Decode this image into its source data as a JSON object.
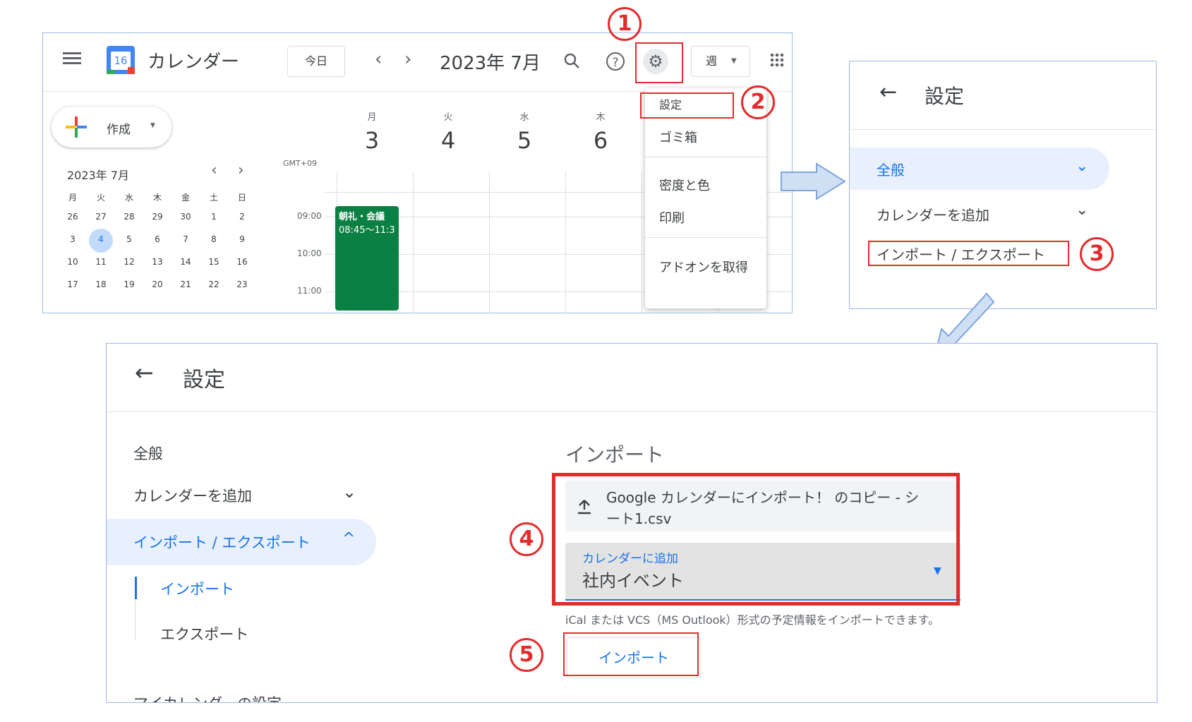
{
  "screen1": {
    "app_title": "カレンダー",
    "logo_day": "16",
    "today_button": "今日",
    "month_label": "2023年 7月",
    "view_button": "週",
    "create_button": "作成",
    "mini_cal": {
      "title": "2023年 7月",
      "weekdays": [
        "月",
        "火",
        "水",
        "木",
        "金",
        "土",
        "日"
      ],
      "weeks": [
        [
          "26",
          "27",
          "28",
          "29",
          "30",
          "1",
          "2"
        ],
        [
          "3",
          "4",
          "5",
          "6",
          "7",
          "8",
          "9"
        ],
        [
          "10",
          "11",
          "12",
          "13",
          "14",
          "15",
          "16"
        ],
        [
          "17",
          "18",
          "19",
          "20",
          "21",
          "22",
          "23"
        ]
      ]
    },
    "timezone": "GMT+09",
    "days": [
      {
        "weekday": "月",
        "date": "3"
      },
      {
        "weekday": "火",
        "date": "4"
      },
      {
        "weekday": "水",
        "date": "5"
      },
      {
        "weekday": "木",
        "date": "6"
      }
    ],
    "times": [
      "09:00",
      "10:00",
      "11:00"
    ],
    "event": {
      "title": "朝礼・会議",
      "time": "08:45〜11:3",
      "color": "#0b8043"
    },
    "settings_menu": [
      "設定",
      "ゴミ箱",
      "密度と色",
      "印刷",
      "アドオンを取得"
    ]
  },
  "screen2": {
    "title": "設定",
    "items": [
      "全般",
      "カレンダーを追加",
      "インポート / エクスポート"
    ]
  },
  "screen3": {
    "title": "設定",
    "nav": {
      "general": "全般",
      "add_calendar": "カレンダーを追加",
      "import_export": "インポート / エクスポート",
      "import": "インポート",
      "export": "エクスポート",
      "my_calendars_partial": "マイカレンダーの設定"
    },
    "import_heading": "インポート",
    "file_name": "Google カレンダーにインポート！ のコピー - シート1.csv",
    "file_name_line1": "Google カレンダーにインポート！ のコピー - シ",
    "file_name_line2": "ート1.csv",
    "select_label": "カレンダーに追加",
    "select_value": "社内イベント",
    "helper_text": "iCal または VCS（MS Outlook）形式の予定情報をインポートできます。",
    "import_button": "インポート"
  },
  "annotations": {
    "step1": "1",
    "step2": "2",
    "step3": "3",
    "step4": "4",
    "step5": "5"
  },
  "colors": {
    "accent": "#1a73e8",
    "annotation": "#e32b2b",
    "selected_bg": "#e8f0fe",
    "event": "#0b8043"
  }
}
